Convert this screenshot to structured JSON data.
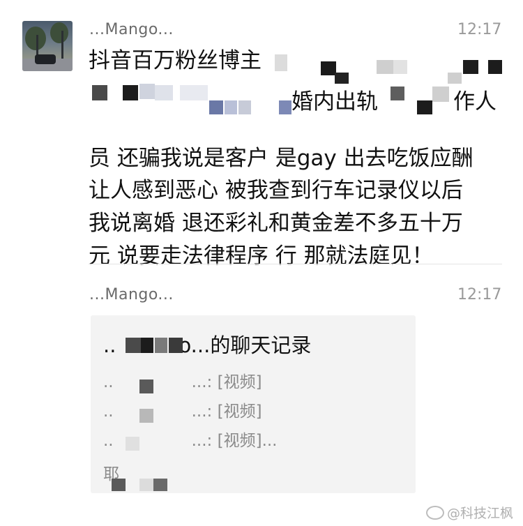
{
  "message1": {
    "sender": "...Mango...",
    "time": "12:17",
    "lines": [
      "抖音百万粉丝博主",
      "婚内出轨",
      "作人",
      "员 还骗我说是客户 是gay 出去吃饭应酬",
      "让人感到恶心 被我查到行车记录仪以后",
      "我说离婚 退还彩礼和黄金差不多五十万",
      "元 说要走法律程序 行 那就法庭见！"
    ]
  },
  "message2": {
    "sender": "...Mango...",
    "time": "12:17",
    "card": {
      "title_prefix": "..",
      "title": "o...的聊天记录",
      "rows": [
        {
          "prefix": "..",
          "text": "...: [视频]"
        },
        {
          "prefix": "..",
          "text": "...: [视频]"
        },
        {
          "prefix": "..",
          "text": "...: [视频]..."
        }
      ],
      "fragment": "耶"
    }
  },
  "watermark": "@科技江枫"
}
